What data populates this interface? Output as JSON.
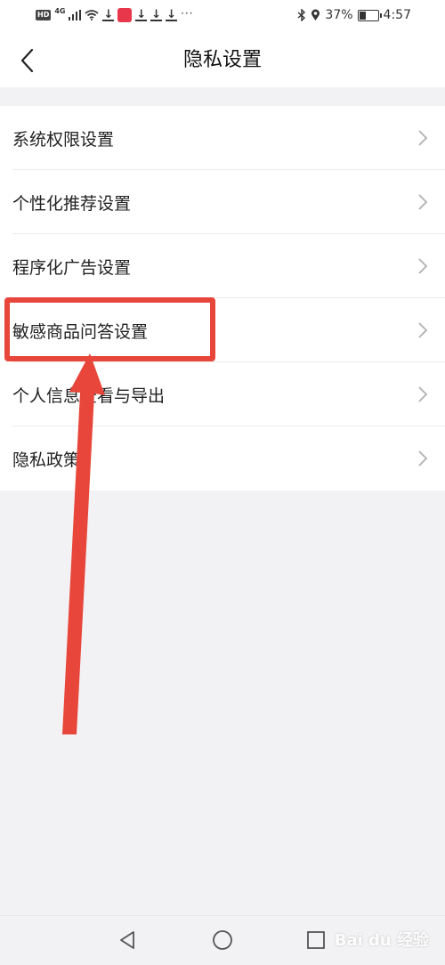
{
  "status_bar": {
    "hd_label": "HD",
    "network_label": "4G",
    "more_dots": "···",
    "battery_percent": "37%",
    "battery_level": 0.37,
    "time": "4:57"
  },
  "header": {
    "title": "隐私设置",
    "back_icon": "chevron-left-icon"
  },
  "settings_items": [
    {
      "label": "系统权限设置"
    },
    {
      "label": "个性化推荐设置"
    },
    {
      "label": "程序化广告设置"
    },
    {
      "label": "敏感商品问答设置"
    },
    {
      "label": "个人信息查看与导出"
    },
    {
      "label": "隐私政策"
    }
  ],
  "annotation": {
    "highlighted_item_index": 3,
    "color": "#e8463a"
  },
  "watermark": {
    "text": "Bai du 经验"
  },
  "nav_bar": {
    "back_icon": "triangle-back-icon",
    "home_icon": "circle-home-icon",
    "recents_icon": "square-recents-icon"
  },
  "colors": {
    "background": "#f2f2f4",
    "card": "#ffffff",
    "chevron": "#b0b0b0"
  }
}
